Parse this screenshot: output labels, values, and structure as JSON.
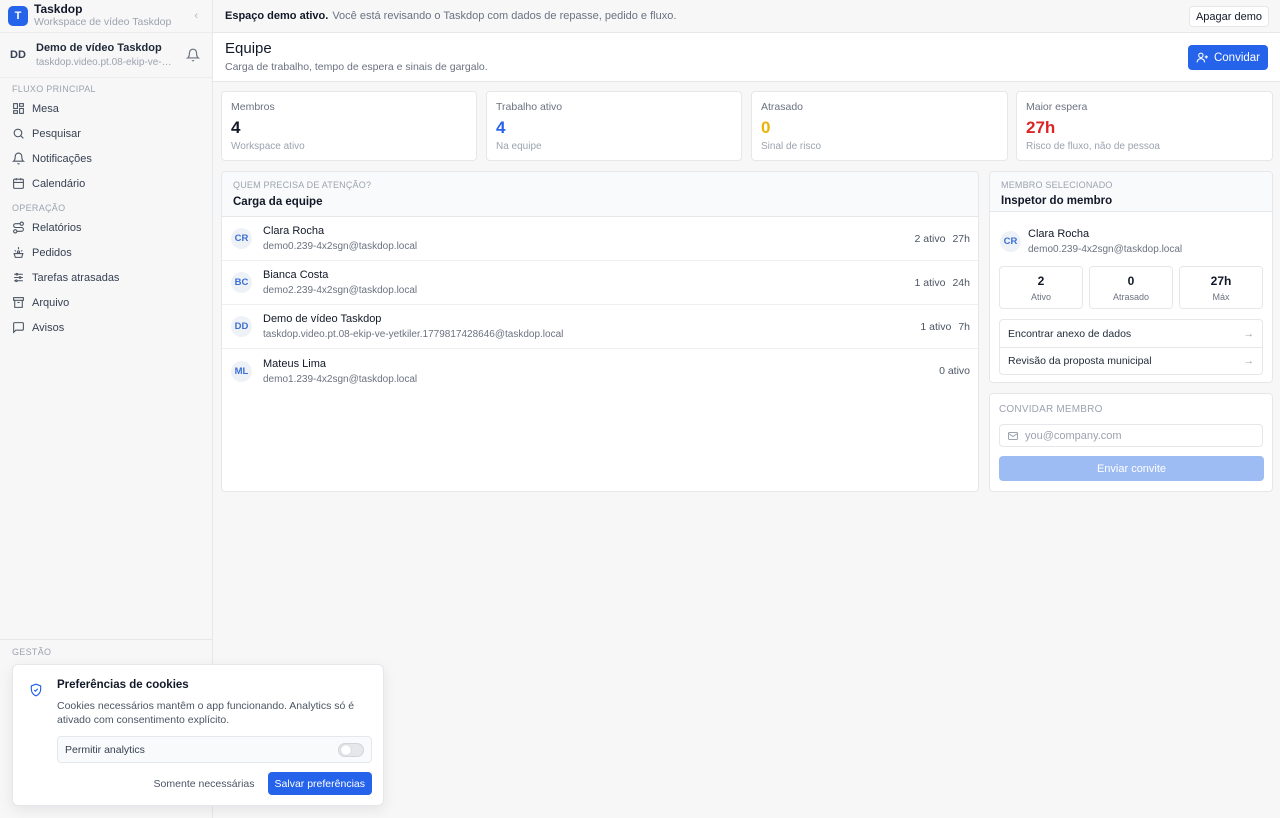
{
  "brand": {
    "logo_letter": "T",
    "name": "Taskdop",
    "subtitle": "Workspace de vídeo Taskdop",
    "collapse_glyph": "‹"
  },
  "user": {
    "initials": "DD",
    "name": "Demo de vídeo Taskdop",
    "email": "taskdop.video.pt.08-ekip-ve-…"
  },
  "sidebar": {
    "section_main": "FLUXO PRINCIPAL",
    "main_items": [
      {
        "label": "Mesa",
        "icon": "dashboard-icon"
      },
      {
        "label": "Pesquisar",
        "icon": "search-icon"
      },
      {
        "label": "Notificações",
        "icon": "bell-icon"
      },
      {
        "label": "Calendário",
        "icon": "calendar-icon"
      }
    ],
    "section_ops": "OPERAÇÃO",
    "ops_items": [
      {
        "label": "Relatórios",
        "icon": "route-icon"
      },
      {
        "label": "Pedidos",
        "icon": "order-icon"
      },
      {
        "label": "Tarefas atrasadas",
        "icon": "sliders-icon"
      },
      {
        "label": "Arquivo",
        "icon": "archive-icon"
      },
      {
        "label": "Avisos",
        "icon": "message-icon"
      }
    ],
    "section_gestao": "GESTÃO"
  },
  "banner": {
    "bold": "Espaço demo ativo.",
    "text": "Você está revisando o Taskdop com dados de repasse, pedido e fluxo.",
    "button": "Apagar demo"
  },
  "header": {
    "title": "Equipe",
    "subtitle": "Carga de trabalho, tempo de espera e sinais de gargalo.",
    "invite_button": "Convidar"
  },
  "stats": [
    {
      "label": "Membros",
      "value": "4",
      "sub": "Workspace ativo",
      "color": "#111827"
    },
    {
      "label": "Trabalho ativo",
      "value": "4",
      "sub": "Na equipe",
      "color": "#2563eb"
    },
    {
      "label": "Atrasado",
      "value": "0",
      "sub": "Sinal de risco",
      "color": "#eab308"
    },
    {
      "label": "Maior espera",
      "value": "27h",
      "sub": "Risco de fluxo, não de pessoa",
      "color": "#dc2626"
    }
  ],
  "team": {
    "kicker": "QUEM PRECISA DE ATENÇÃO?",
    "title": "Carga da equipe",
    "members": [
      {
        "initials": "CR",
        "name": "Clara Rocha",
        "email": "demo0.239-4x2sgn@taskdop.local",
        "active": "2 ativo",
        "wait": "27h"
      },
      {
        "initials": "BC",
        "name": "Bianca Costa",
        "email": "demo2.239-4x2sgn@taskdop.local",
        "active": "1 ativo",
        "wait": "24h"
      },
      {
        "initials": "DD",
        "name": "Demo de vídeo Taskdop",
        "email": "taskdop.video.pt.08-ekip-ve-yetkiler.1779817428646@taskdop.local",
        "active": "1 ativo",
        "wait": "7h"
      },
      {
        "initials": "ML",
        "name": "Mateus Lima",
        "email": "demo1.239-4x2sgn@taskdop.local",
        "active": "0 ativo",
        "wait": ""
      }
    ]
  },
  "inspector": {
    "kicker": "MEMBRO SELECIONADO",
    "title": "Inspetor do membro",
    "member": {
      "initials": "CR",
      "name": "Clara Rocha",
      "email": "demo0.239-4x2sgn@taskdop.local"
    },
    "mini_stats": [
      {
        "value": "2",
        "label": "Ativo"
      },
      {
        "value": "0",
        "label": "Atrasado"
      },
      {
        "value": "27h",
        "label": "Máx"
      }
    ],
    "tasks": [
      {
        "label": "Encontrar anexo de dados",
        "arrow": "→"
      },
      {
        "label": "Revisão da proposta municipal",
        "arrow": "→"
      }
    ]
  },
  "invite": {
    "label": "CONVIDAR MEMBRO",
    "email_placeholder": "you@company.com",
    "email_value": "",
    "button": "Enviar convite"
  },
  "cookie": {
    "title": "Preferências de cookies",
    "text": "Cookies necessários mantêm o app funcionando. Analytics só é ativado com consentimento explícito.",
    "toggle_label": "Permitir analytics",
    "analytics_enabled": false,
    "btn_necessary": "Somente necessárias",
    "btn_save": "Salvar preferências"
  },
  "colors": {
    "accent": "#2563eb",
    "warning": "#eab308",
    "danger": "#dc2626"
  }
}
